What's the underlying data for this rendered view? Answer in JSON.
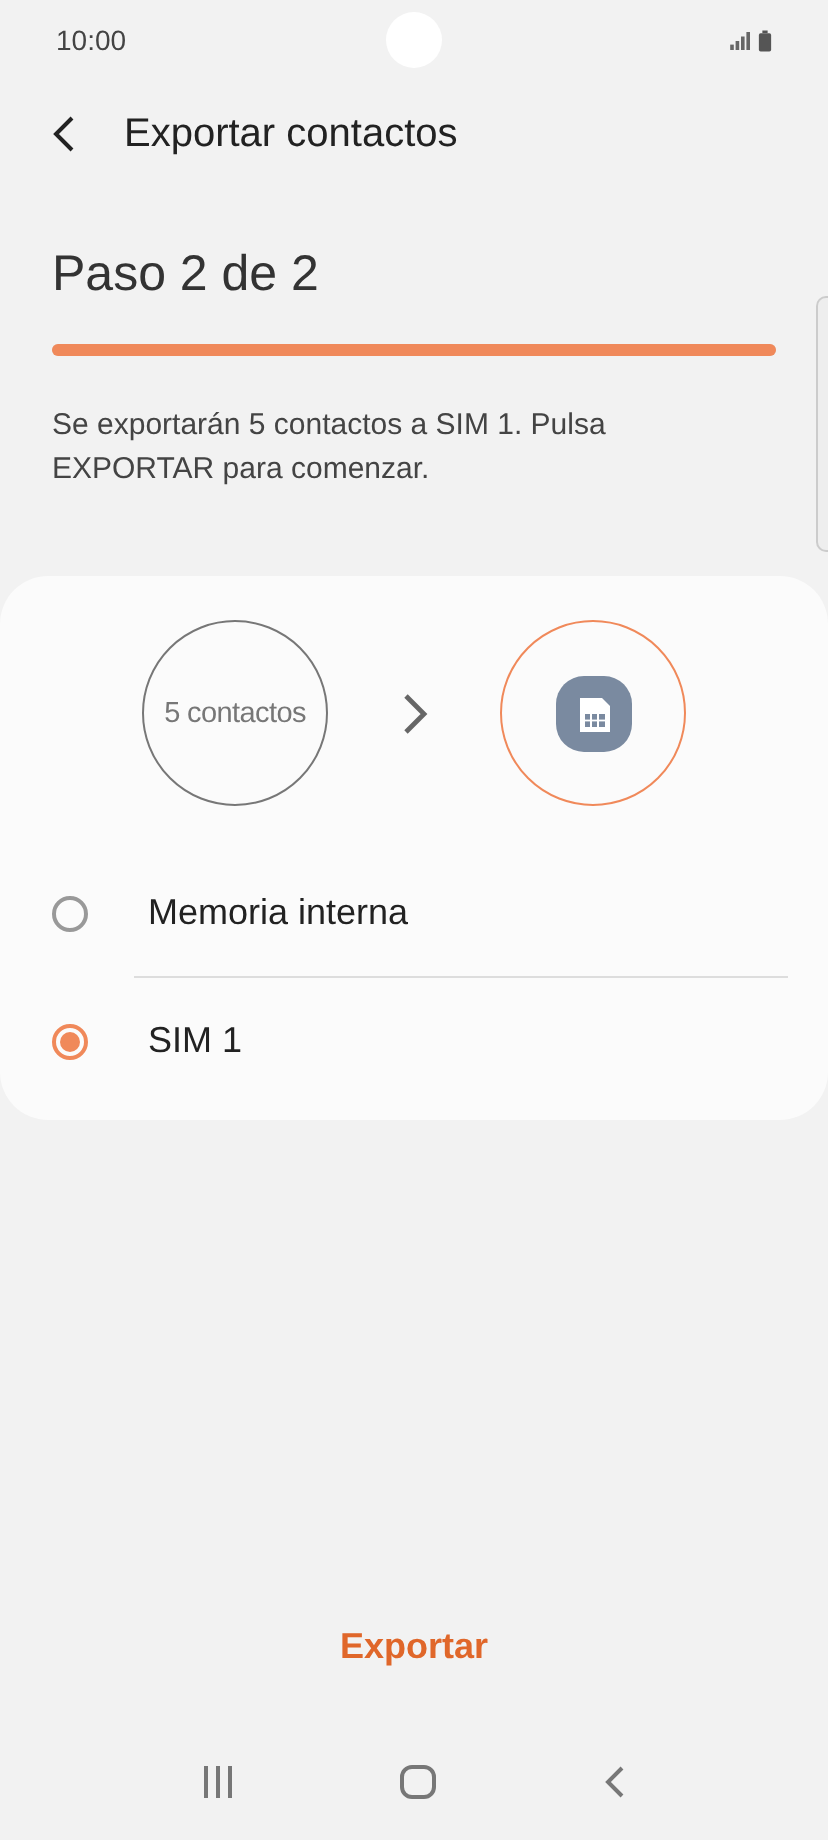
{
  "status_bar": {
    "time": "10:00"
  },
  "header": {
    "title": "Exportar contactos"
  },
  "step": {
    "title": "Paso 2 de 2",
    "level": 1
  },
  "description": "Se exportarán 5 contactos a SIM 1. Pulsa EXPORTAR para comenzar.",
  "transfer": {
    "source": "5 contactos"
  },
  "options": [
    {
      "label": "Memoria interna",
      "selected": false
    },
    {
      "label": "SIM 1",
      "selected": true
    }
  ],
  "action": "Exportar"
}
